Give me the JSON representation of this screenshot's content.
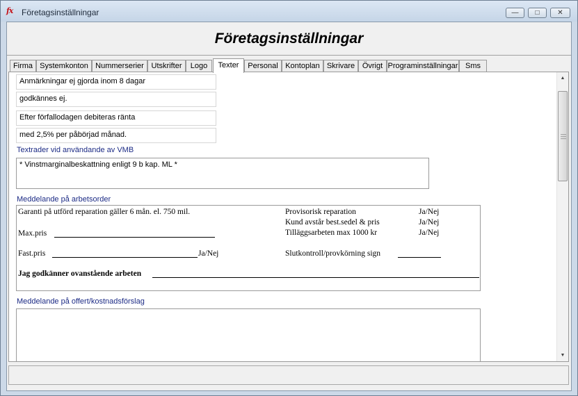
{
  "window": {
    "title": "Företagsinställningar",
    "app_icon": "fx"
  },
  "header": {
    "title": "Företagsinställningar"
  },
  "tabs": [
    "Firma",
    "Systemkonton",
    "Nummerserier",
    "Utskrifter",
    "Logo",
    "Texter",
    "Personal",
    "Kontoplan",
    "Skrivare",
    "Övrigt",
    "Programinställningar",
    "Sms"
  ],
  "active_tab": "Texter",
  "texts": {
    "lines": [
      "Anmärkningar ej gjorda inom 8 dagar",
      "godkännes ej.",
      "Efter förfallodagen debiteras ränta",
      "med 2,5% per påbörjad månad."
    ],
    "vmb_label": "Textrader vid användande av VMB",
    "vmb_text": "* Vinstmarginalbeskattning enligt 9 b kap. ML *",
    "workorder_label": "Meddelande på arbetsorder",
    "workorder": {
      "line1": "Garanti på utförd reparation gäller 6 mån. el. 750 mil.",
      "maxpris": "Max.pris",
      "fastpris": "Fast.pris",
      "janej": "Ja/Nej",
      "approve": "Jag godkänner ovanstående arbeten",
      "right_items": [
        "Provisorisk reparation",
        "Kund avstår best.sedel & pris",
        "Tilläggsarbeten max 1000 kr"
      ],
      "right_values": [
        "Ja/Nej",
        "Ja/Nej",
        "Ja/Nej"
      ],
      "slutkontroll": "Slutkontroll/provkörning sign"
    },
    "offer_label": "Meddelande på offert/kostnadsförslag",
    "offer_text": ""
  },
  "status": {
    "text": ""
  }
}
